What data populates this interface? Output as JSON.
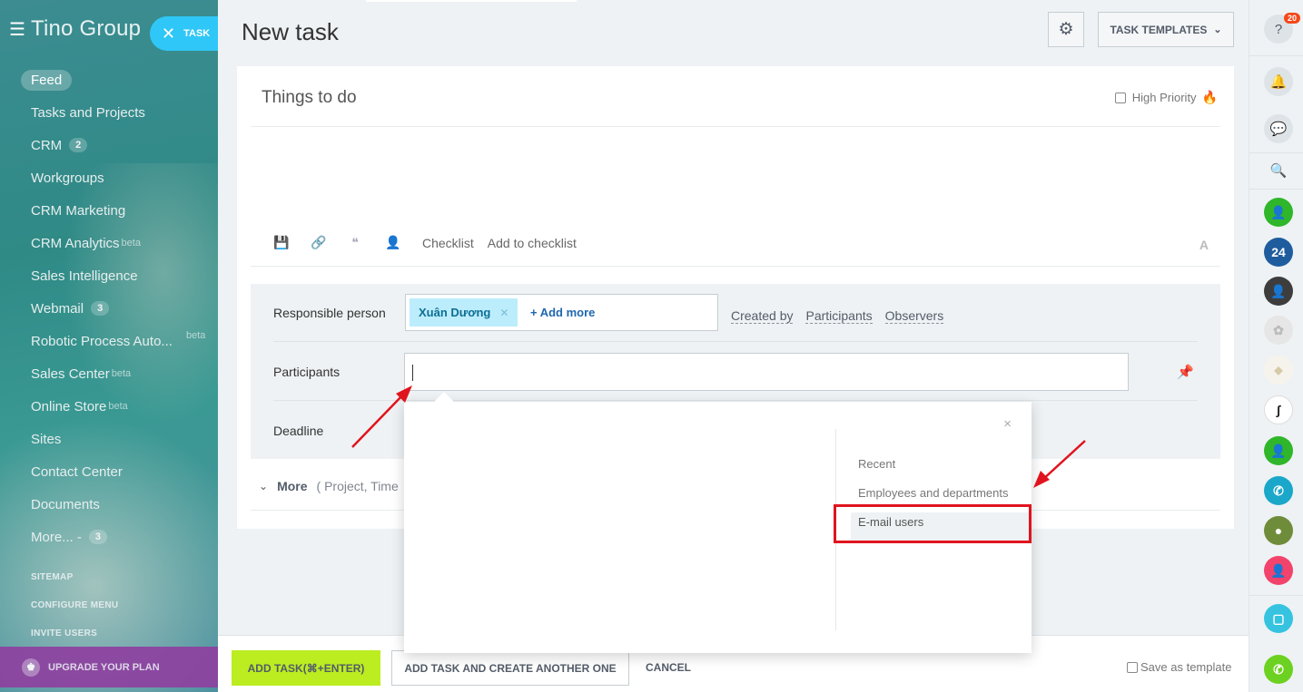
{
  "app": {
    "brand": "Tino Group",
    "task_chip": "TASK"
  },
  "nav": {
    "items": [
      {
        "label": "Feed",
        "active": true
      },
      {
        "label": "Tasks and Projects"
      },
      {
        "label": "CRM",
        "count": "2"
      },
      {
        "label": "Workgroups"
      },
      {
        "label": "CRM Marketing"
      },
      {
        "label": "CRM Analytics",
        "sup": "beta"
      },
      {
        "label": "Sales Intelligence"
      },
      {
        "label": "Webmail",
        "count": "3"
      },
      {
        "label": "Robotic Process Auto...",
        "sup": "beta"
      },
      {
        "label": "Sales Center",
        "sup": "beta"
      },
      {
        "label": "Online Store",
        "sup": "beta"
      },
      {
        "label": "Sites"
      },
      {
        "label": "Contact Center"
      },
      {
        "label": "Documents"
      },
      {
        "label": "More... -",
        "count": "3"
      }
    ],
    "small_links": [
      "SITEMAP",
      "CONFIGURE MENU",
      "INVITE USERS"
    ],
    "upgrade": "UPGRADE YOUR PLAN"
  },
  "header": {
    "title": "New task",
    "templates_button": "TASK TEMPLATES"
  },
  "editor": {
    "placeholder": "Things to do",
    "high_priority": "High Priority",
    "toolbar": {
      "checklist": "Checklist",
      "add_to_checklist": "Add to checklist"
    }
  },
  "form": {
    "responsible_label": "Responsible person",
    "responsible_tag": "Xuân Dương",
    "add_more": "+ Add more",
    "role_links": [
      "Created by",
      "Participants",
      "Observers"
    ],
    "participants_label": "Participants",
    "deadline_label": "Deadline",
    "more_label": "More",
    "more_hint": "( Project,  Time"
  },
  "popup": {
    "close": "×",
    "menu": [
      {
        "label": "Recent"
      },
      {
        "label": "Employees and departments"
      },
      {
        "label": "E-mail users",
        "selected": true
      }
    ]
  },
  "footer": {
    "add_task": "ADD TASK(⌘+ENTER)",
    "add_another": "ADD TASK AND CREATE ANOTHER ONE",
    "cancel": "CANCEL",
    "save_template": "Save as template"
  },
  "right_panel": {
    "help_badge": "20",
    "bitrix_label": "24"
  },
  "colors": {
    "accent_green": "#bbed21",
    "chip_blue": "#2fc7f7",
    "highlight_red": "#e0141e"
  }
}
